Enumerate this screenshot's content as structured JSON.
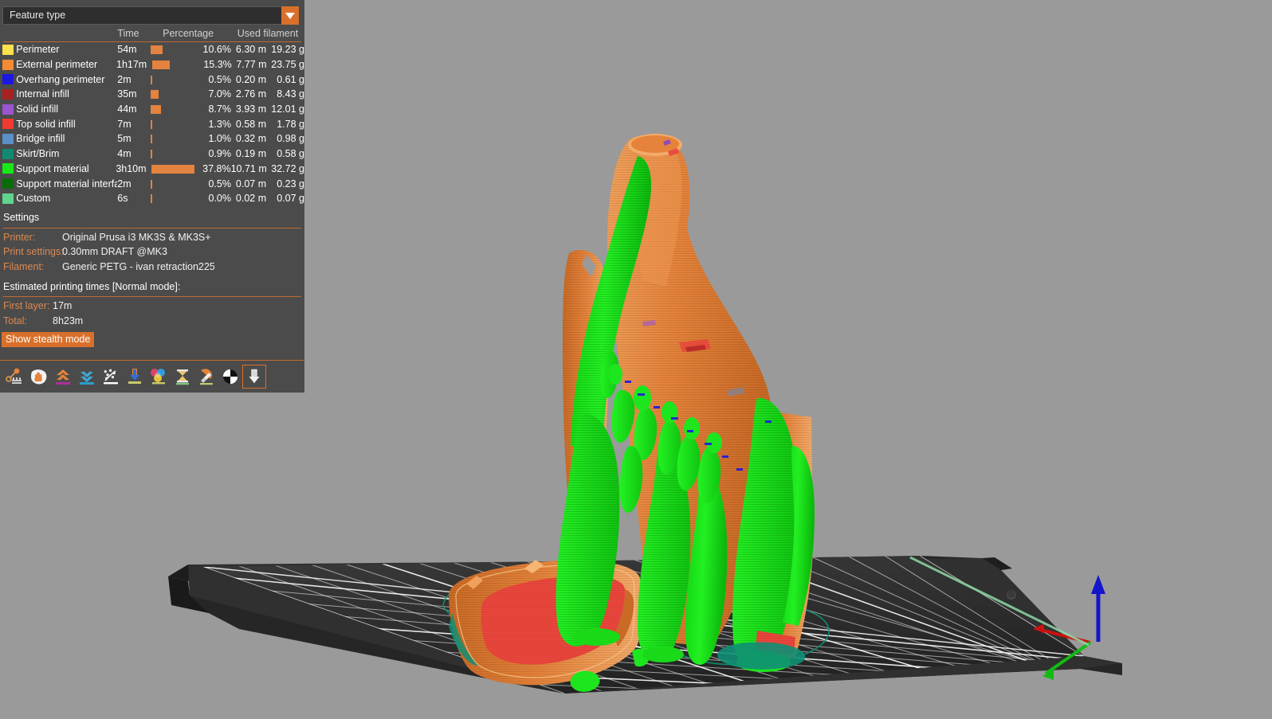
{
  "app": {
    "viewport_background": "#9a9a9a",
    "panel_background": "#4b4b4b",
    "accent_color": "#d9702a"
  },
  "legend": {
    "view_type_select": {
      "value": "Feature type",
      "placeholder": "Feature type",
      "dropdown_icon": "chevron-down-icon"
    },
    "columns": {
      "feature": "",
      "time": "Time",
      "percentage": "Percentage",
      "used_filament": "Used filament"
    },
    "rows": [
      {
        "color": "#fbe14c",
        "name": "Perimeter",
        "time": "54m",
        "bar_pct": 10.6,
        "percentage": "10.6%",
        "length": "6.30 m",
        "weight": "19.23 g"
      },
      {
        "color": "#f58a34",
        "name": "External perimeter",
        "time": "1h17m",
        "bar_pct": 15.3,
        "percentage": "15.3%",
        "length": "7.77 m",
        "weight": "23.75 g"
      },
      {
        "color": "#1c18e3",
        "name": "Overhang perimeter",
        "time": "2m",
        "bar_pct": 0.5,
        "percentage": "0.5%",
        "length": "0.20 m",
        "weight": "0.61 g"
      },
      {
        "color": "#a92020",
        "name": "Internal infill",
        "time": "35m",
        "bar_pct": 7.0,
        "percentage": "7.0%",
        "length": "2.76 m",
        "weight": "8.43 g"
      },
      {
        "color": "#9b54d1",
        "name": "Solid infill",
        "time": "44m",
        "bar_pct": 8.7,
        "percentage": "8.7%",
        "length": "3.93 m",
        "weight": "12.01 g"
      },
      {
        "color": "#f23b30",
        "name": "Top solid infill",
        "time": "7m",
        "bar_pct": 1.3,
        "percentage": "1.3%",
        "length": "0.58 m",
        "weight": "1.78 g"
      },
      {
        "color": "#5b8fc9",
        "name": "Bridge infill",
        "time": "5m",
        "bar_pct": 1.0,
        "percentage": "1.0%",
        "length": "0.32 m",
        "weight": "0.98 g"
      },
      {
        "color": "#108a70",
        "name": "Skirt/Brim",
        "time": "4m",
        "bar_pct": 0.9,
        "percentage": "0.9%",
        "length": "0.19 m",
        "weight": "0.58 g"
      },
      {
        "color": "#18e818",
        "name": "Support material",
        "time": "3h10m",
        "bar_pct": 37.8,
        "percentage": "37.8%",
        "length": "10.71 m",
        "weight": "32.72 g"
      },
      {
        "color": "#0a6b0a",
        "name": "Support material interface",
        "time": "2m",
        "bar_pct": 0.5,
        "percentage": "0.5%",
        "length": "0.07 m",
        "weight": "0.23 g"
      },
      {
        "color": "#5fd48d",
        "name": "Custom",
        "time": "6s",
        "bar_pct": 0.0,
        "percentage": "0.0%",
        "length": "0.02 m",
        "weight": "0.07 g"
      }
    ]
  },
  "settings": {
    "heading": "Settings",
    "printer_label": "Printer:",
    "printer_value": "Original Prusa i3 MK3S & MK3S+",
    "print_settings_label": "Print settings:",
    "print_settings_value": "0.30mm DRAFT @MK3",
    "filament_label": "Filament:",
    "filament_value": "Generic PETG - ivan retraction225"
  },
  "estimates": {
    "heading": "Estimated printing times [Normal mode]:",
    "first_layer_label": "First layer:",
    "first_layer_value": "17m",
    "total_label": "Total:",
    "total_value": "8h23m",
    "stealth_button": "Show stealth mode"
  },
  "toolbar": {
    "items": [
      {
        "name": "travel-icon",
        "label": "Travel"
      },
      {
        "name": "retractions-icon",
        "label": "Retractions"
      },
      {
        "name": "deretractions-icon",
        "label": "Deretractions"
      },
      {
        "name": "seams-icon",
        "label": "Seams"
      },
      {
        "name": "tool-changes-icon",
        "label": "Tool changes"
      },
      {
        "name": "color-changes-icon",
        "label": "Color changes"
      },
      {
        "name": "pause-prints-icon",
        "label": "Pause prints"
      },
      {
        "name": "custom-gcodes-icon",
        "label": "Custom G-codes"
      },
      {
        "name": "shells-icon",
        "label": "Shells"
      },
      {
        "name": "tool-marker-icon",
        "label": "Tool marker",
        "selected": true
      }
    ]
  },
  "viewport": {
    "axes": {
      "x_color": "#cc1111",
      "y_color": "#12bb12",
      "z_color": "#1515cc"
    },
    "bed_color": "#2b2b2b",
    "grid_color": "#ffffff",
    "model_colors": {
      "external_perimeter": "#e5833b",
      "support_material": "#1ee61e",
      "top_solid_infill": "#e8453b",
      "skirt_brim": "#0e8f74"
    }
  }
}
